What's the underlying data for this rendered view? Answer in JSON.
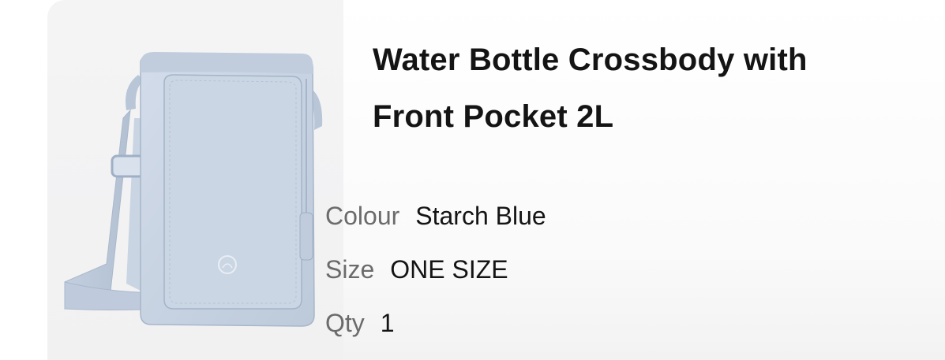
{
  "product": {
    "title_line1": "Water Bottle Crossbody with",
    "title_line2": "Front Pocket 2L",
    "image_alt": "Water Bottle Crossbody with Front Pocket 2L in Starch Blue",
    "attributes": [
      {
        "label": "Colour",
        "value": "Starch Blue"
      },
      {
        "label": "Size",
        "value": "ONE SIZE"
      },
      {
        "label": "Qty",
        "value": "1"
      }
    ]
  },
  "colors": {
    "bag": "#c9d4e2",
    "bag_shadow": "#aebccf",
    "panel_bg": "#f2f2f3",
    "text_primary": "#141414",
    "text_secondary": "#6b6b6b"
  },
  "icons": {
    "logo": "brand-logo-icon"
  }
}
